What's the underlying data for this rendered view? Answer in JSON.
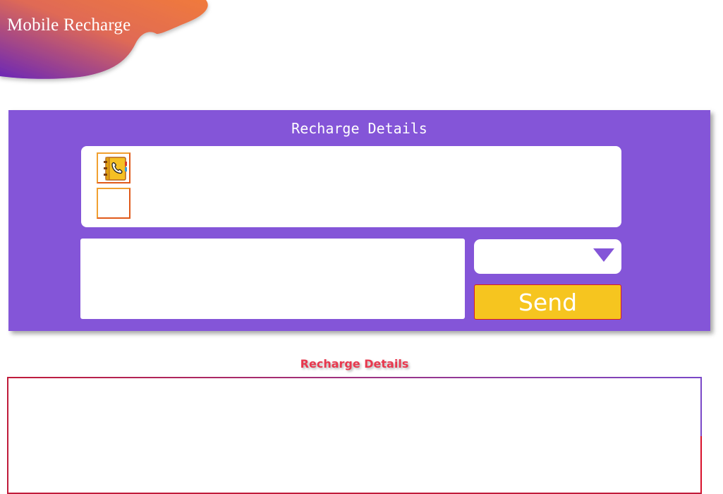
{
  "app": {
    "title": "Mobile Recharge"
  },
  "colors": {
    "panel_bg": "#8455d8",
    "send_button_bg": "#f6c51f",
    "send_button_border": "#d81e1e",
    "results_title": "#e8384e",
    "header_gradient_start": "#6a26b8",
    "header_gradient_end": "#f07a3c"
  },
  "recharge_form": {
    "title": "Recharge Details",
    "contact_buttons": [
      {
        "icon": "phonebook-icon"
      },
      {
        "icon": ""
      }
    ],
    "message_field": {
      "value": "",
      "placeholder": ""
    },
    "operator_select": {
      "selected": "",
      "icon": "dropdown-arrow-icon"
    },
    "send_label": "Send"
  },
  "results": {
    "title": "Recharge Details"
  }
}
